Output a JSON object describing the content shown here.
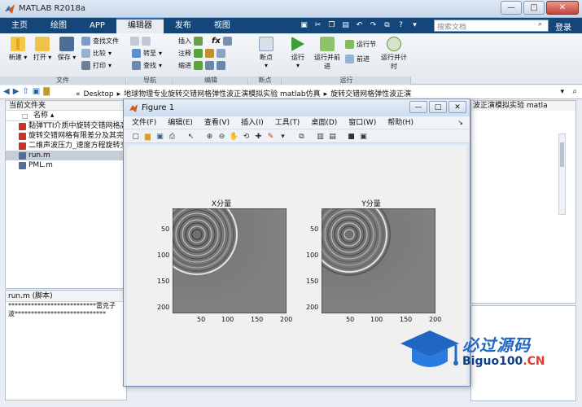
{
  "window": {
    "title": "MATLAB R2018a",
    "minimize": "—",
    "maximize": "□",
    "close": "✕"
  },
  "tabs": [
    {
      "label": "主页"
    },
    {
      "label": "绘图"
    },
    {
      "label": "APP"
    },
    {
      "label": "编辑器",
      "active": true
    },
    {
      "label": "发布"
    },
    {
      "label": "视图"
    }
  ],
  "toolbar": {
    "search_placeholder": "搜索文档",
    "login": "登录"
  },
  "ribbon": {
    "file": {
      "new": "新建",
      "open": "打开",
      "save": "保存",
      "find_files": "查找文件",
      "compare": "比较",
      "print": "打印",
      "group": "文件"
    },
    "nav": {
      "goto": "转至",
      "find": "查找",
      "group": "导航"
    },
    "edit": {
      "insert": "插入",
      "comment": "注释",
      "indent": "缩进",
      "fx": "fx",
      "group": "编辑"
    },
    "breakpoints": {
      "label": "断点",
      "group": "断点"
    },
    "run": {
      "run": "运行",
      "run_advance": "运行并前进",
      "run_section": "运行节",
      "advance": "前进",
      "run_time": "运行并计时",
      "group": "运行"
    }
  },
  "address": {
    "segments": [
      "«",
      "Desktop",
      "▸",
      "地球物理专业旋转交错网格弹性波正演模拟实验 matlab仿真",
      "▸",
      "旋转交错网格弹性波正演"
    ]
  },
  "left_panel": {
    "title": "当前文件夹",
    "column": "名称",
    "files": [
      {
        "name": "黏弹TTI介质中旋转交错网格高阶有限差分数值模拟.pdf",
        "type": "pdf"
      },
      {
        "name": "旋转交错网格有限差分及其完全匹配层吸收边界条件.pdf",
        "type": "pdf"
      },
      {
        "name": "二维声波压力_速度方程旋转交错网格.pdf",
        "type": "pdf"
      },
      {
        "name": "run.m",
        "type": "m",
        "selected": true
      },
      {
        "name": "PML.m",
        "type": "m"
      }
    ]
  },
  "editor": {
    "title": "run.m (脚本)",
    "lines": [
      "***************************雷克子",
      "波****************************"
    ]
  },
  "right_panel": {
    "header": "波正演模拟实验 matla"
  },
  "figure": {
    "title": "Figure 1",
    "menu": [
      "文件(F)",
      "编辑(E)",
      "查看(V)",
      "插入(I)",
      "工具(T)",
      "桌面(D)",
      "窗口(W)",
      "帮助(H)"
    ],
    "axes": [
      {
        "title": "X分量",
        "yticks": [
          "50",
          "100",
          "150",
          "200"
        ],
        "xticks": [
          "50",
          "100",
          "150",
          "200"
        ]
      },
      {
        "title": "Y分量",
        "yticks": [
          "50",
          "100",
          "150",
          "200"
        ],
        "xticks": [
          "50",
          "100",
          "150",
          "200"
        ]
      }
    ]
  },
  "watermark": {
    "text_main": "必过源码",
    "text_url": "Biguo100",
    "text_url_suffix": ".CN"
  }
}
